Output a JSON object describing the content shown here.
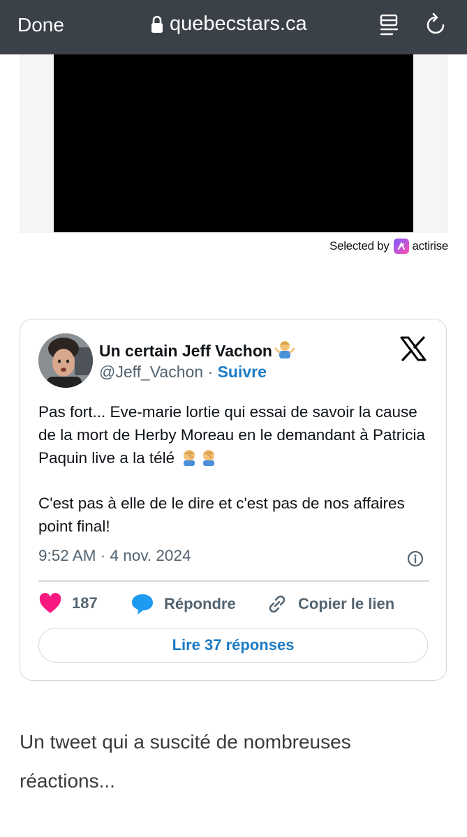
{
  "browser": {
    "done_label": "Done",
    "url": "quebecstars.ca",
    "icons": {
      "lock": "lock-icon",
      "reader": "reader-list-icon",
      "reload": "reload-icon"
    },
    "bar_color": "#3b4149"
  },
  "ad": {
    "selected_by_label": "Selected by",
    "brand": "actirise"
  },
  "tweet": {
    "author_name": "Un certain Jeff Vachon",
    "author_emoji": "🤷‍♂️",
    "handle": "@Jeff_Vachon",
    "separator": " · ",
    "follow_label": "Suivre",
    "paragraph_1": "Pas fort... Eve-marie lortie qui essai de savoir la cause de la mort de Herby Moreau en le demandant à Patricia Paquin live a la télé",
    "paragraph_1_emoji": "🤦‍♂️🤦‍♂️",
    "paragraph_2": "C'est pas à elle de le dire et c'est pas de nos affaires point final!",
    "timestamp": "9:52 AM · 4 nov. 2024",
    "like_count": "187",
    "reply_label": "Répondre",
    "copy_link_label": "Copier le lien",
    "read_replies_label": "Lire 37 réponses",
    "colors": {
      "like": "#f91880",
      "reply": "#1d9bf0",
      "link": "#1d7bc4",
      "muted": "#536471"
    }
  },
  "article": {
    "caption": "Un tweet qui a suscité de nombreuses réactions..."
  }
}
